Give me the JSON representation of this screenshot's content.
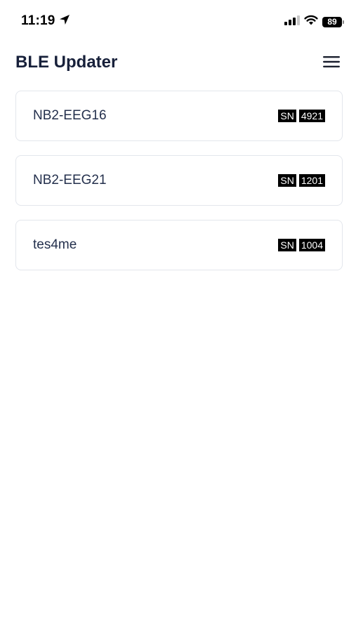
{
  "status_bar": {
    "time": "11:19",
    "battery": "89",
    "icons": [
      "location-arrow-icon",
      "cellular-signal-icon",
      "wifi-icon",
      "battery-icon"
    ]
  },
  "header": {
    "title": "BLE Updater",
    "menu_icon": "hamburger-menu-icon"
  },
  "devices": [
    {
      "name": "NB2-EEG16",
      "sn_label": "SN",
      "sn_value": "4921"
    },
    {
      "name": "NB2-EEG21",
      "sn_label": "SN",
      "sn_value": "1201"
    },
    {
      "name": "tes4me",
      "sn_label": "SN",
      "sn_value": "1004"
    }
  ]
}
